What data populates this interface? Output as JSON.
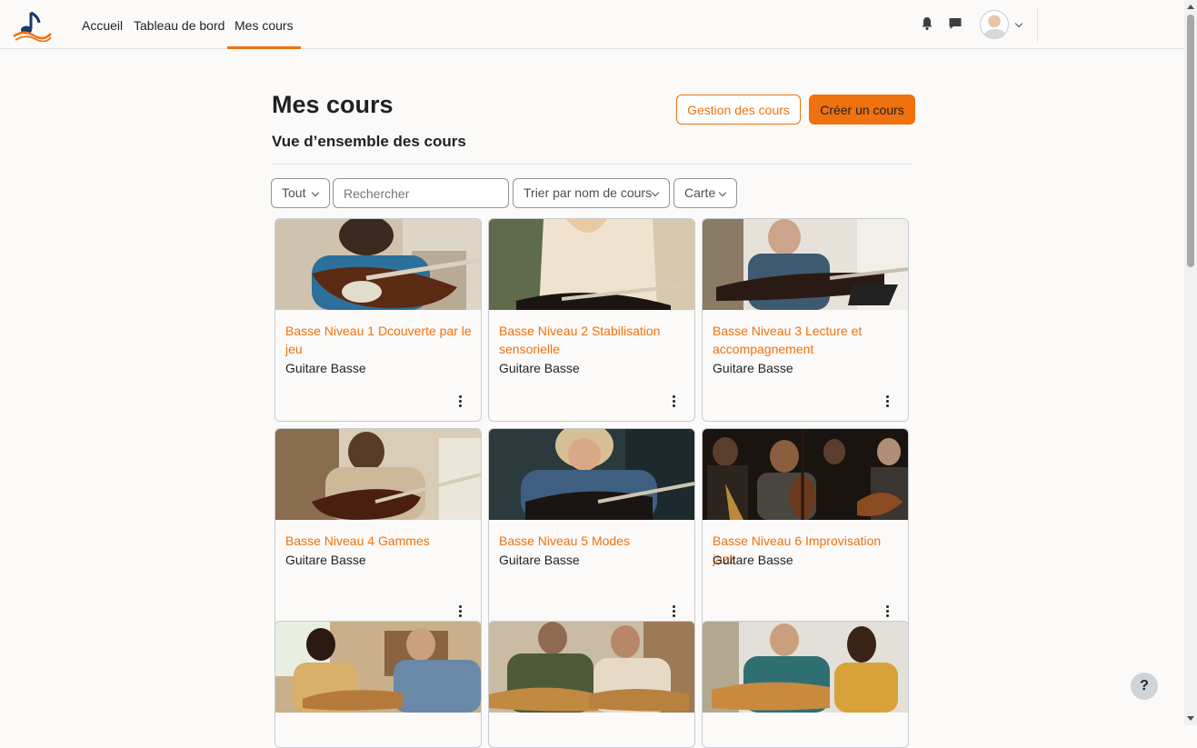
{
  "nav": {
    "links": [
      "Accueil",
      "Tableau de bord",
      "Mes cours"
    ]
  },
  "header": {
    "title": "Mes cours",
    "subtitle": "Vue d’ensemble des cours",
    "manage_button": "Gestion des cours",
    "create_button": "Créer un cours"
  },
  "filters": {
    "grouping": "Tout",
    "search_placeholder": "Rechercher",
    "sort": "Trier par nom de cours",
    "view": "Carte"
  },
  "courses": [
    {
      "name": "Basse Niveau 1 Dcouverte par le jeu",
      "category": "Guitare Basse"
    },
    {
      "name": "Basse Niveau 2 Stabilisation sensorielle",
      "category": "Guitare Basse"
    },
    {
      "name": "Basse Niveau 3 Lecture et accompagnement",
      "category": "Guitare Basse"
    },
    {
      "name": "Basse Niveau 4 Gammes",
      "category": "Guitare Basse"
    },
    {
      "name": "Basse Niveau 5 Modes",
      "category": "Guitare Basse"
    },
    {
      "name": "Basse Niveau 6 Improvisation jazz",
      "category": "Guitare Basse"
    }
  ],
  "help": "?",
  "colors": {
    "accent": "#f0710f",
    "text": "#1d2125",
    "background": "#fbfaf8"
  },
  "icons": [
    "music-note-logo-icon",
    "bell-icon",
    "chat-icon",
    "chevron-down-icon",
    "kebab-menu-icon",
    "help-icon"
  ]
}
